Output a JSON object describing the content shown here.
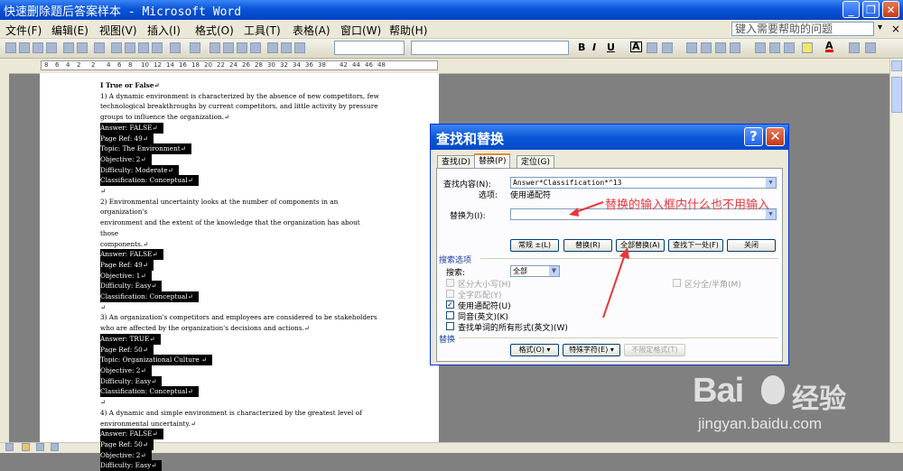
{
  "window": {
    "title": "快速删除题后答案样本 - Microsoft Word",
    "minimize_glyph": "_",
    "maximize_glyph": "❐",
    "close_glyph": "✕"
  },
  "menu": {
    "items": [
      "文件(F)",
      "编辑(E)",
      "视图(V)",
      "插入(I)",
      "格式(O)",
      "工具(T)",
      "表格(A)",
      "窗口(W)",
      "帮助(H)"
    ],
    "help_placeholder": "键入需要帮助的问题",
    "help_arrow": "▾",
    "close_doc": "×"
  },
  "formatting": {
    "bold": "B",
    "italic": "I",
    "underline": "U",
    "char_border": "A",
    "font_color": "A"
  },
  "ruler": {
    "ticks": [
      "8",
      "6",
      "4",
      "2",
      "2",
      "4",
      "6",
      "8",
      "10",
      "12",
      "14",
      "16",
      "18",
      "20",
      "22",
      "24",
      "26",
      "28",
      "30",
      "32",
      "34",
      "36",
      "38",
      "42",
      "44",
      "46",
      "48"
    ]
  },
  "document": {
    "lines": [
      {
        "text": "I  True or False↵",
        "hl": false,
        "bold": true
      },
      {
        "text": "1) A dynamic environment is characterized by the absence of new competitors, few",
        "hl": false
      },
      {
        "text": "technological breakthroughs by current competitors, and little activity by pressure",
        "hl": false
      },
      {
        "text": "groups to influence the organization.↵",
        "hl": false
      },
      {
        "text": "Answer:    FALSE↵",
        "hl": true
      },
      {
        "text": "Page Ref: 49↵",
        "hl": true
      },
      {
        "text": "Topic:    The Environment↵",
        "hl": true
      },
      {
        "text": "Objective:    2↵",
        "hl": true
      },
      {
        "text": "Difficulty:    Moderate↵",
        "hl": true
      },
      {
        "text": "Classification:    Conceptual↵",
        "hl": true
      },
      {
        "text": "↵",
        "hl": false
      },
      {
        "text": "2) Environmental uncertainty looks at the number of components in an organization's",
        "hl": false
      },
      {
        "text": "environment and the extent of the knowledge that the organization has about those",
        "hl": false
      },
      {
        "text": "components.↵",
        "hl": false
      },
      {
        "text": "Answer:    FALSE↵",
        "hl": true
      },
      {
        "text": "Page Ref: 49↵",
        "hl": true
      },
      {
        "text": "Objective:    1↵",
        "hl": true
      },
      {
        "text": "Difficulty:    Easy↵",
        "hl": true
      },
      {
        "text": "Classification:    Conceptual↵",
        "hl": true
      },
      {
        "text": "↵",
        "hl": false
      },
      {
        "text": "3) An organization's competitors and employees are considered to be stakeholders",
        "hl": false
      },
      {
        "text": "who are affected by the organization's decisions and actions.↵",
        "hl": false
      },
      {
        "text": "Answer:    TRUE↵",
        "hl": true
      },
      {
        "text": "Page Ref: 50↵",
        "hl": true
      },
      {
        "text": "Topic:    Organizational Culture   ↵",
        "hl": true
      },
      {
        "text": "Objective:    2↵",
        "hl": true
      },
      {
        "text": "Difficulty:    Easy↵",
        "hl": true
      },
      {
        "text": "Classification:    Conceptual↵",
        "hl": true
      },
      {
        "text": "↵",
        "hl": false
      },
      {
        "text": "4) A dynamic and simple environment is characterized by the greatest level of",
        "hl": false
      },
      {
        "text": "environmental uncertainty.↵",
        "hl": false
      },
      {
        "text": "Answer:    FALSE↵",
        "hl": true
      },
      {
        "text": "Page Ref: 50↵",
        "hl": true
      },
      {
        "text": "Objective:    2↵",
        "hl": true
      },
      {
        "text": "Difficulty:    Easy↵",
        "hl": true
      }
    ]
  },
  "dialog": {
    "title": "查找和替换",
    "help_glyph": "?",
    "close_glyph": "✕",
    "tabs": [
      "查找(D)",
      "替换(P)",
      "定位(G)"
    ],
    "find_label": "查找内容(N):",
    "find_value": "Answer*Classification*^13",
    "options_label": "选项:",
    "options_value": "使用通配符",
    "replace_label": "替换为(I):",
    "replace_value": "",
    "buttons": {
      "fewer": "常规 ±(L)",
      "replace": "替换(R)",
      "replace_all": "全部替换(A)",
      "find_next": "查找下一处(F)",
      "close": "关闭"
    },
    "search_options_title": "搜索选项",
    "search_label": "搜索:",
    "search_value": "全部",
    "checks": {
      "match_case": "区分大小写(H)",
      "whole_word": "全字匹配(Y)",
      "wildcards": "使用通配符(U)",
      "sounds_like": "同音(英文)(K)",
      "all_forms": "查找单词的所有形式(英文)(W)",
      "half_full": "区分全/半角(M)"
    },
    "replace_section_title": "替换",
    "bottom_buttons": {
      "format": "格式(O) ▾",
      "special": "特殊字符(E) ▾",
      "no_format": "不限定格式(T)"
    }
  },
  "annotation": {
    "text": "替换的输入框内什么也不用输入",
    "color": "#e8383d"
  },
  "watermark": {
    "brand": "Bai",
    "brand_suffix": "经验",
    "url": "jingyan.baidu.com"
  },
  "colors": {
    "title_blue": "#0a55d8",
    "annotation_red": "#e8383d"
  }
}
